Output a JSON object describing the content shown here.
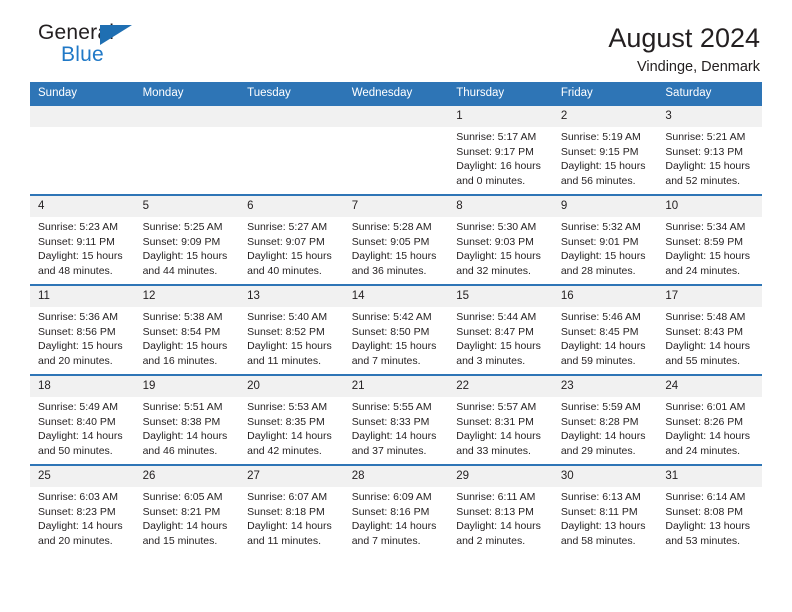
{
  "brand": {
    "name_top": "General",
    "name_bottom": "Blue",
    "triangle_color": "#1f6fb2",
    "blue_color": "#2079c7"
  },
  "header": {
    "title": "August 2024",
    "subtitle": "Vindinge, Denmark"
  },
  "theme": {
    "header_row_bg": "#2e75b6",
    "daynum_bg": "#f1f1f1",
    "text": "#231f20"
  },
  "weekdays": [
    "Sunday",
    "Monday",
    "Tuesday",
    "Wednesday",
    "Thursday",
    "Friday",
    "Saturday"
  ],
  "weeks": [
    [
      {
        "empty": true
      },
      {
        "empty": true
      },
      {
        "empty": true
      },
      {
        "empty": true
      },
      {
        "day": "1",
        "sunrise": "Sunrise: 5:17 AM",
        "sunset": "Sunset: 9:17 PM",
        "daylight1": "Daylight: 16 hours",
        "daylight2": "and 0 minutes."
      },
      {
        "day": "2",
        "sunrise": "Sunrise: 5:19 AM",
        "sunset": "Sunset: 9:15 PM",
        "daylight1": "Daylight: 15 hours",
        "daylight2": "and 56 minutes."
      },
      {
        "day": "3",
        "sunrise": "Sunrise: 5:21 AM",
        "sunset": "Sunset: 9:13 PM",
        "daylight1": "Daylight: 15 hours",
        "daylight2": "and 52 minutes."
      }
    ],
    [
      {
        "day": "4",
        "sunrise": "Sunrise: 5:23 AM",
        "sunset": "Sunset: 9:11 PM",
        "daylight1": "Daylight: 15 hours",
        "daylight2": "and 48 minutes."
      },
      {
        "day": "5",
        "sunrise": "Sunrise: 5:25 AM",
        "sunset": "Sunset: 9:09 PM",
        "daylight1": "Daylight: 15 hours",
        "daylight2": "and 44 minutes."
      },
      {
        "day": "6",
        "sunrise": "Sunrise: 5:27 AM",
        "sunset": "Sunset: 9:07 PM",
        "daylight1": "Daylight: 15 hours",
        "daylight2": "and 40 minutes."
      },
      {
        "day": "7",
        "sunrise": "Sunrise: 5:28 AM",
        "sunset": "Sunset: 9:05 PM",
        "daylight1": "Daylight: 15 hours",
        "daylight2": "and 36 minutes."
      },
      {
        "day": "8",
        "sunrise": "Sunrise: 5:30 AM",
        "sunset": "Sunset: 9:03 PM",
        "daylight1": "Daylight: 15 hours",
        "daylight2": "and 32 minutes."
      },
      {
        "day": "9",
        "sunrise": "Sunrise: 5:32 AM",
        "sunset": "Sunset: 9:01 PM",
        "daylight1": "Daylight: 15 hours",
        "daylight2": "and 28 minutes."
      },
      {
        "day": "10",
        "sunrise": "Sunrise: 5:34 AM",
        "sunset": "Sunset: 8:59 PM",
        "daylight1": "Daylight: 15 hours",
        "daylight2": "and 24 minutes."
      }
    ],
    [
      {
        "day": "11",
        "sunrise": "Sunrise: 5:36 AM",
        "sunset": "Sunset: 8:56 PM",
        "daylight1": "Daylight: 15 hours",
        "daylight2": "and 20 minutes."
      },
      {
        "day": "12",
        "sunrise": "Sunrise: 5:38 AM",
        "sunset": "Sunset: 8:54 PM",
        "daylight1": "Daylight: 15 hours",
        "daylight2": "and 16 minutes."
      },
      {
        "day": "13",
        "sunrise": "Sunrise: 5:40 AM",
        "sunset": "Sunset: 8:52 PM",
        "daylight1": "Daylight: 15 hours",
        "daylight2": "and 11 minutes."
      },
      {
        "day": "14",
        "sunrise": "Sunrise: 5:42 AM",
        "sunset": "Sunset: 8:50 PM",
        "daylight1": "Daylight: 15 hours",
        "daylight2": "and 7 minutes."
      },
      {
        "day": "15",
        "sunrise": "Sunrise: 5:44 AM",
        "sunset": "Sunset: 8:47 PM",
        "daylight1": "Daylight: 15 hours",
        "daylight2": "and 3 minutes."
      },
      {
        "day": "16",
        "sunrise": "Sunrise: 5:46 AM",
        "sunset": "Sunset: 8:45 PM",
        "daylight1": "Daylight: 14 hours",
        "daylight2": "and 59 minutes."
      },
      {
        "day": "17",
        "sunrise": "Sunrise: 5:48 AM",
        "sunset": "Sunset: 8:43 PM",
        "daylight1": "Daylight: 14 hours",
        "daylight2": "and 55 minutes."
      }
    ],
    [
      {
        "day": "18",
        "sunrise": "Sunrise: 5:49 AM",
        "sunset": "Sunset: 8:40 PM",
        "daylight1": "Daylight: 14 hours",
        "daylight2": "and 50 minutes."
      },
      {
        "day": "19",
        "sunrise": "Sunrise: 5:51 AM",
        "sunset": "Sunset: 8:38 PM",
        "daylight1": "Daylight: 14 hours",
        "daylight2": "and 46 minutes."
      },
      {
        "day": "20",
        "sunrise": "Sunrise: 5:53 AM",
        "sunset": "Sunset: 8:35 PM",
        "daylight1": "Daylight: 14 hours",
        "daylight2": "and 42 minutes."
      },
      {
        "day": "21",
        "sunrise": "Sunrise: 5:55 AM",
        "sunset": "Sunset: 8:33 PM",
        "daylight1": "Daylight: 14 hours",
        "daylight2": "and 37 minutes."
      },
      {
        "day": "22",
        "sunrise": "Sunrise: 5:57 AM",
        "sunset": "Sunset: 8:31 PM",
        "daylight1": "Daylight: 14 hours",
        "daylight2": "and 33 minutes."
      },
      {
        "day": "23",
        "sunrise": "Sunrise: 5:59 AM",
        "sunset": "Sunset: 8:28 PM",
        "daylight1": "Daylight: 14 hours",
        "daylight2": "and 29 minutes."
      },
      {
        "day": "24",
        "sunrise": "Sunrise: 6:01 AM",
        "sunset": "Sunset: 8:26 PM",
        "daylight1": "Daylight: 14 hours",
        "daylight2": "and 24 minutes."
      }
    ],
    [
      {
        "day": "25",
        "sunrise": "Sunrise: 6:03 AM",
        "sunset": "Sunset: 8:23 PM",
        "daylight1": "Daylight: 14 hours",
        "daylight2": "and 20 minutes."
      },
      {
        "day": "26",
        "sunrise": "Sunrise: 6:05 AM",
        "sunset": "Sunset: 8:21 PM",
        "daylight1": "Daylight: 14 hours",
        "daylight2": "and 15 minutes."
      },
      {
        "day": "27",
        "sunrise": "Sunrise: 6:07 AM",
        "sunset": "Sunset: 8:18 PM",
        "daylight1": "Daylight: 14 hours",
        "daylight2": "and 11 minutes."
      },
      {
        "day": "28",
        "sunrise": "Sunrise: 6:09 AM",
        "sunset": "Sunset: 8:16 PM",
        "daylight1": "Daylight: 14 hours",
        "daylight2": "and 7 minutes."
      },
      {
        "day": "29",
        "sunrise": "Sunrise: 6:11 AM",
        "sunset": "Sunset: 8:13 PM",
        "daylight1": "Daylight: 14 hours",
        "daylight2": "and 2 minutes."
      },
      {
        "day": "30",
        "sunrise": "Sunrise: 6:13 AM",
        "sunset": "Sunset: 8:11 PM",
        "daylight1": "Daylight: 13 hours",
        "daylight2": "and 58 minutes."
      },
      {
        "day": "31",
        "sunrise": "Sunrise: 6:14 AM",
        "sunset": "Sunset: 8:08 PM",
        "daylight1": "Daylight: 13 hours",
        "daylight2": "and 53 minutes."
      }
    ]
  ]
}
